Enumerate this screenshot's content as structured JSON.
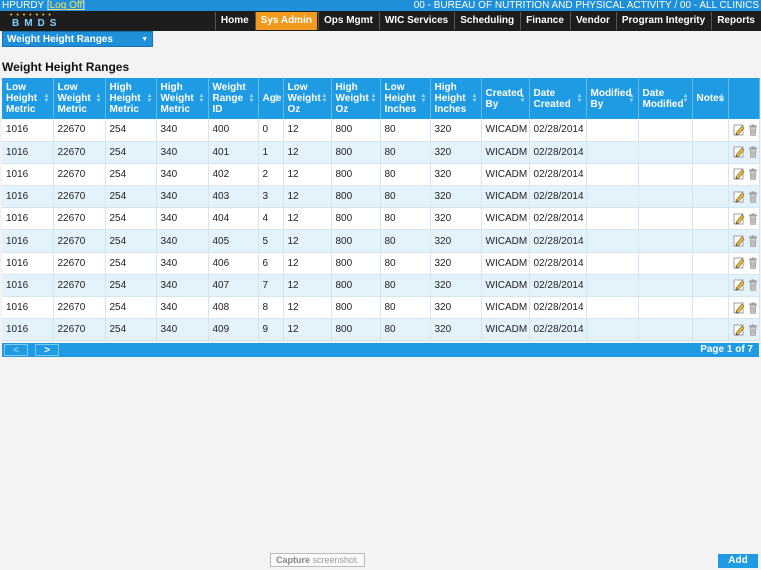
{
  "topbar": {
    "user": "HPURDY",
    "logoff_label": "Log Off",
    "org_line": "00 - BUREAU OF NUTRITION AND PHYSICAL ACTIVITY / 00 - ALL CLINICS"
  },
  "logo": {
    "text": "BMDS"
  },
  "nav": [
    {
      "label": "Home",
      "active": false
    },
    {
      "label": "Sys Admin",
      "active": true
    },
    {
      "label": "Ops Mgmt",
      "active": false
    },
    {
      "label": "WIC Services",
      "active": false
    },
    {
      "label": "Scheduling",
      "active": false
    },
    {
      "label": "Finance",
      "active": false
    },
    {
      "label": "Vendor",
      "active": false
    },
    {
      "label": "Program Integrity",
      "active": false
    },
    {
      "label": "Reports",
      "active": false
    }
  ],
  "selector": {
    "value": "Weight Height Ranges"
  },
  "page": {
    "title": "Weight Height Ranges"
  },
  "table": {
    "columns": [
      "Low Height Metric",
      "Low Weight Metric",
      "High Height Metric",
      "High Weight Metric",
      "Weight Range ID",
      "Age",
      "Low Weight Oz",
      "High Weight Oz",
      "Low Height Inches",
      "High Height Inches",
      "Created By",
      "Date Created",
      "Modified By",
      "Date Modified",
      "Notes",
      ""
    ],
    "rows": [
      [
        "1016",
        "22670",
        "254",
        "340",
        "400",
        "0",
        "12",
        "800",
        "80",
        "320",
        "WICADM",
        "02/28/2014",
        "",
        "",
        ""
      ],
      [
        "1016",
        "22670",
        "254",
        "340",
        "401",
        "1",
        "12",
        "800",
        "80",
        "320",
        "WICADM",
        "02/28/2014",
        "",
        "",
        ""
      ],
      [
        "1016",
        "22670",
        "254",
        "340",
        "402",
        "2",
        "12",
        "800",
        "80",
        "320",
        "WICADM",
        "02/28/2014",
        "",
        "",
        ""
      ],
      [
        "1016",
        "22670",
        "254",
        "340",
        "403",
        "3",
        "12",
        "800",
        "80",
        "320",
        "WICADM",
        "02/28/2014",
        "",
        "",
        ""
      ],
      [
        "1016",
        "22670",
        "254",
        "340",
        "404",
        "4",
        "12",
        "800",
        "80",
        "320",
        "WICADM",
        "02/28/2014",
        "",
        "",
        ""
      ],
      [
        "1016",
        "22670",
        "254",
        "340",
        "405",
        "5",
        "12",
        "800",
        "80",
        "320",
        "WICADM",
        "02/28/2014",
        "",
        "",
        ""
      ],
      [
        "1016",
        "22670",
        "254",
        "340",
        "406",
        "6",
        "12",
        "800",
        "80",
        "320",
        "WICADM",
        "02/28/2014",
        "",
        "",
        ""
      ],
      [
        "1016",
        "22670",
        "254",
        "340",
        "407",
        "7",
        "12",
        "800",
        "80",
        "320",
        "WICADM",
        "02/28/2014",
        "",
        "",
        ""
      ],
      [
        "1016",
        "22670",
        "254",
        "340",
        "408",
        "8",
        "12",
        "800",
        "80",
        "320",
        "WICADM",
        "02/28/2014",
        "",
        "",
        ""
      ],
      [
        "1016",
        "22670",
        "254",
        "340",
        "409",
        "9",
        "12",
        "800",
        "80",
        "320",
        "WICADM",
        "02/28/2014",
        "",
        "",
        ""
      ]
    ]
  },
  "pager": {
    "prev": "<",
    "next": ">",
    "info": "Page 1 of 7"
  },
  "tooltip": {
    "bold": "Capture",
    "rest": " screenshot."
  },
  "add_label": "Add",
  "icons": {
    "edit": "pencil-icon",
    "delete": "trash-icon",
    "sort": "sort-arrows-icon",
    "dropdown": "caret-down-icon"
  },
  "colors": {
    "accent": "#1e9be3",
    "nav_active": "#f29a1e",
    "nav_bg": "#1d1d1d",
    "row_alt": "#e4f2fb"
  }
}
